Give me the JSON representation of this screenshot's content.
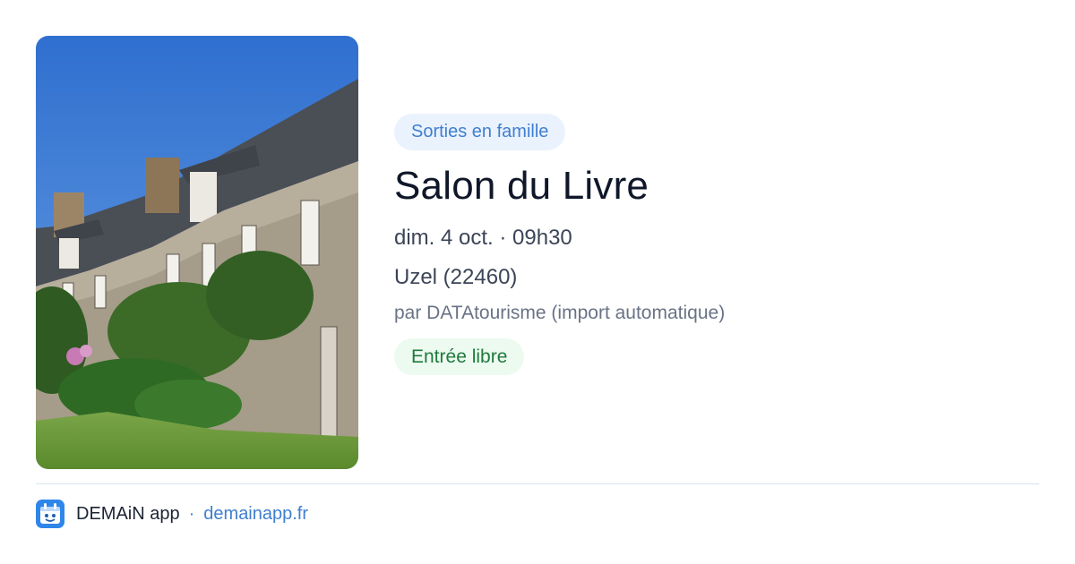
{
  "event": {
    "image": {
      "icon": "photo-stone-manor-house",
      "sky_color": "#3f7fd6",
      "grass_color": "#6b9a3a"
    },
    "category": "Sorties en famille",
    "title": "Salon du Livre",
    "datetime": "dim. 4 oct. · 09h30",
    "location": "Uzel (22460)",
    "organizer": "par DATAtourisme (import automatique)",
    "price": "Entrée libre"
  },
  "footer": {
    "app_icon": "demain-app-icon",
    "app_name": "DEMAiN app",
    "separator": "·",
    "url": "demainapp.fr"
  },
  "colors": {
    "accent_blue": "#3f7fd0",
    "category_chip_bg": "#eaf2fd",
    "price_green": "#1f7a3e",
    "price_chip_bg": "#ecfaef",
    "title_color": "#0f1729"
  }
}
